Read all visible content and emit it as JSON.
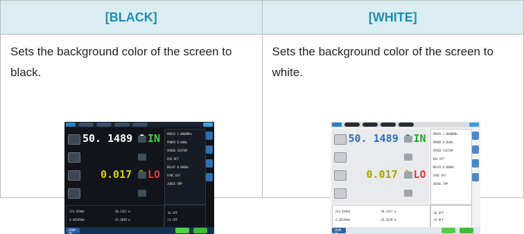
{
  "headers": [
    "[BLACK]",
    "[WHITE]"
  ],
  "descriptions": [
    "Sets the background color of the screen to black.",
    "Sets the background color of the screen to white."
  ],
  "screen": {
    "primary_value": "50. 1489 Ω",
    "secondary_value": "0.017 °",
    "judge_top": "IN",
    "judge_bottom": "LO",
    "btn_labels": [
      "OFF",
      "OFF",
      "OFF"
    ],
    "settings": [
      "PRESS  1.0000MHz",
      "POWER  0.0dBm",
      "SPEED  CUSTOM",
      "AVG    OFF",
      "DELAY  0.0000s",
      "SYNC   OFF",
      "JUDGE  CMP"
    ],
    "bottom_readouts": [
      "223.939mV",
      "4.4654RmA",
      "50.1357 Ω",
      "43.3639 Ω"
    ],
    "side_bottom": [
      "SG  OFF",
      "LV  OFF"
    ],
    "footer_label": "ZOOM ON"
  },
  "colors": {
    "header_bg": "#daeef1",
    "header_text": "#1f8bb5",
    "border": "#b9b9b9"
  }
}
